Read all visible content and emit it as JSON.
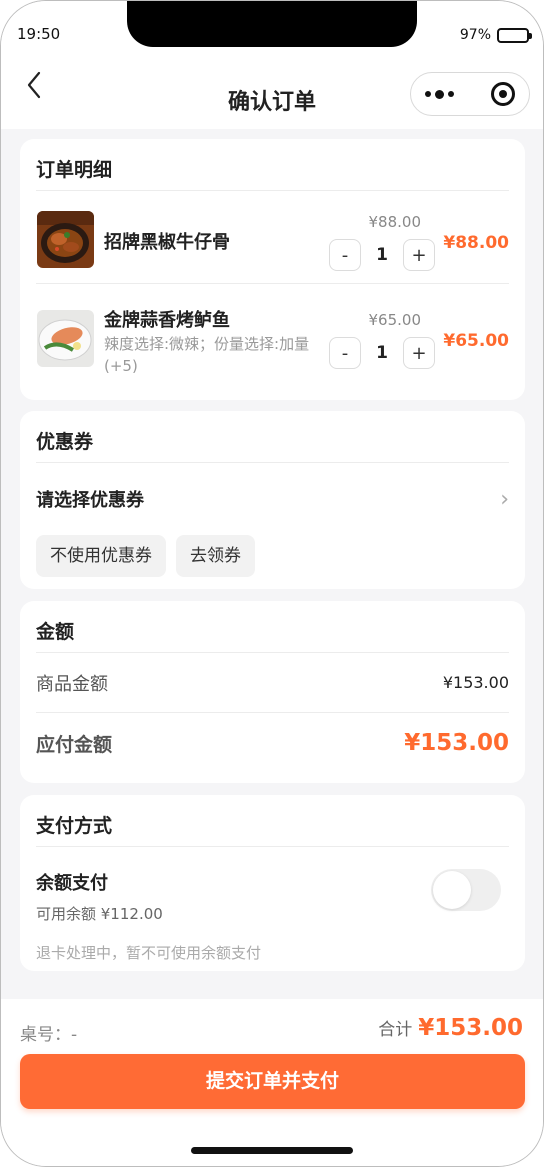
{
  "status_bar": {
    "time": "19:50",
    "battery": "97%"
  },
  "nav": {
    "title": "确认订单"
  },
  "order": {
    "title": "订单明细",
    "items": [
      {
        "name": "招牌黑椒牛仔骨",
        "spec": "",
        "unit_price": "¥88.00",
        "qty": "1",
        "total": "¥88.00"
      },
      {
        "name": "金牌蒜香烤鲈鱼",
        "spec": "辣度选择:微辣；份量选择:加量(+5)",
        "unit_price": "¥65.00",
        "qty": "1",
        "total": "¥65.00"
      }
    ],
    "minus_label": "-",
    "plus_label": "+"
  },
  "coupon": {
    "title": "优惠券",
    "select_label": "请选择优惠券",
    "no_coupon": "不使用优惠券",
    "get_coupon": "去领券"
  },
  "amount": {
    "title": "金额",
    "goods_label": "商品金额",
    "goods_value": "¥153.00",
    "payable_label": "应付金额",
    "payable_value": "¥153.00"
  },
  "payment": {
    "title": "支付方式",
    "method": "余额支付",
    "balance": "可用余额 ¥112.00",
    "note": "退卡处理中，暂不可使用余额支付",
    "enabled": false
  },
  "bottom": {
    "table_no": "桌号：-",
    "total_label": "合计",
    "total_value": "¥153.00",
    "submit_label": "提交订单并支付"
  },
  "colors": {
    "accent": "#ff6b35",
    "price": "#ff6a2e"
  }
}
